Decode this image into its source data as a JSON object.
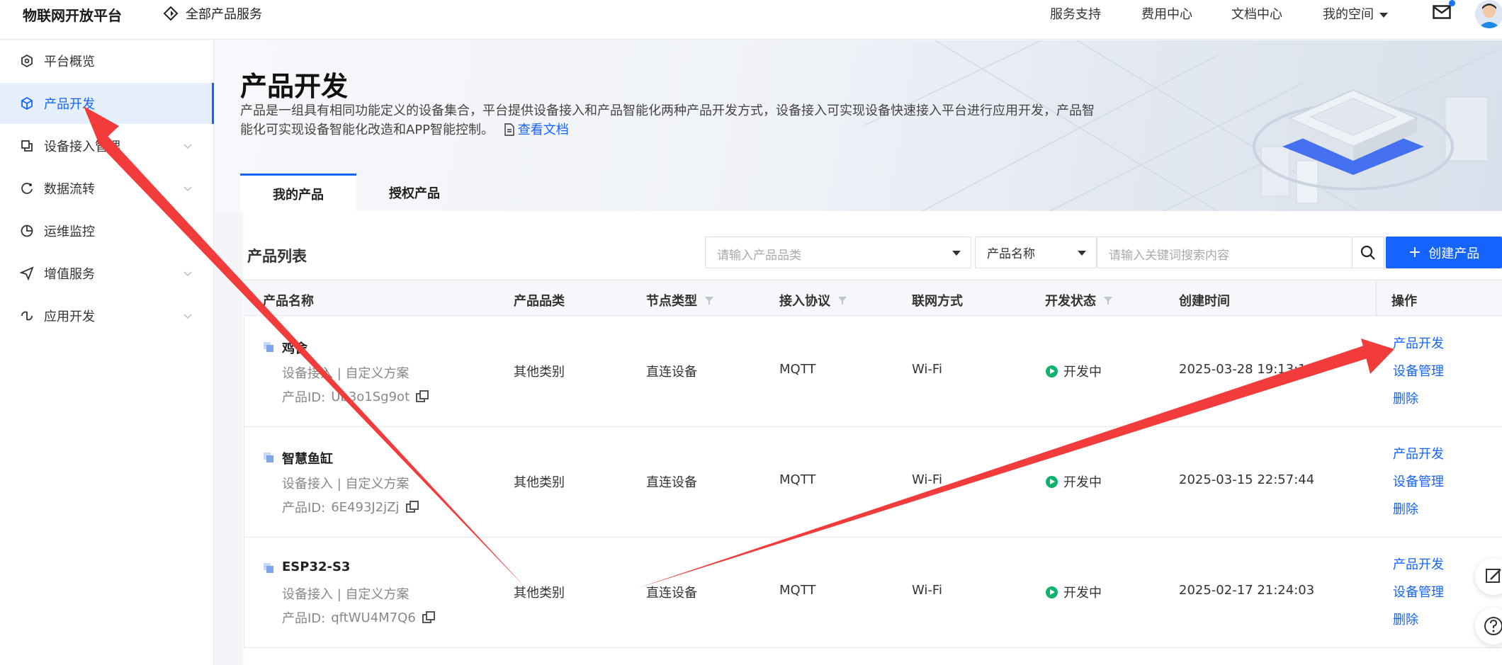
{
  "header": {
    "logo": "物联网开放平台",
    "all_products": "全部产品服务",
    "nav": [
      "服务支持",
      "费用中心",
      "文档中心",
      "我的空间"
    ]
  },
  "sidebar": {
    "items": [
      {
        "label": "平台概览",
        "icon": "hexagon-icon"
      },
      {
        "label": "产品开发",
        "icon": "cube-icon"
      },
      {
        "label": "设备接入管理",
        "icon": "device-icon"
      },
      {
        "label": "数据流转",
        "icon": "data-flow-icon"
      },
      {
        "label": "运维监控",
        "icon": "pie-chart-icon"
      },
      {
        "label": "增值服务",
        "icon": "send-icon"
      },
      {
        "label": "应用开发",
        "icon": "app-icon"
      }
    ]
  },
  "banner": {
    "title": "产品开发",
    "desc": "产品是一组具有相同功能定义的设备集合，平台提供设备接入和产品智能化两种产品开发方式，设备接入可实现设备快速接入平台进行应用开发，产品智能化可实现设备智能化改造和APP智能控制。",
    "doc_link": "查看文档",
    "tabs": [
      "我的产品",
      "授权产品"
    ]
  },
  "list": {
    "title": "产品列表",
    "category_placeholder": "请输入产品品类",
    "field_select": "产品名称",
    "search_placeholder": "请输入关键词搜索内容",
    "create_button": "创建产品",
    "columns": [
      "产品名称",
      "产品品类",
      "节点类型",
      "接入协议",
      "联网方式",
      "开发状态",
      "创建时间",
      "操作"
    ],
    "id_label": "产品ID:",
    "rows": [
      {
        "name": "鸡舍",
        "sub": "设备接入  |  自定义方案",
        "id": "Ub3o1Sg9ot",
        "category": "其他类别",
        "node": "直连设备",
        "protocol": "MQTT",
        "network": "Wi-Fi",
        "status": "开发中",
        "created": "2025-03-28 19:13:11"
      },
      {
        "name": "智慧鱼缸",
        "sub": "设备接入  |  自定义方案",
        "id": "6E493J2jZj",
        "category": "其他类别",
        "node": "直连设备",
        "protocol": "MQTT",
        "network": "Wi-Fi",
        "status": "开发中",
        "created": "2025-03-15 22:57:44"
      },
      {
        "name": "ESP32-S3",
        "sub": "设备接入  |  自定义方案",
        "id": "qftWU4M7Q6",
        "category": "其他类别",
        "node": "直连设备",
        "protocol": "MQTT",
        "network": "Wi-Fi",
        "status": "开发中",
        "created": "2025-02-17 21:24:03"
      }
    ],
    "actions": [
      "产品开发",
      "设备管理",
      "删除"
    ]
  },
  "colors": {
    "accent": "#1664ff",
    "status_green": "#0fb36d",
    "annotation_red": "#f23b3b"
  }
}
